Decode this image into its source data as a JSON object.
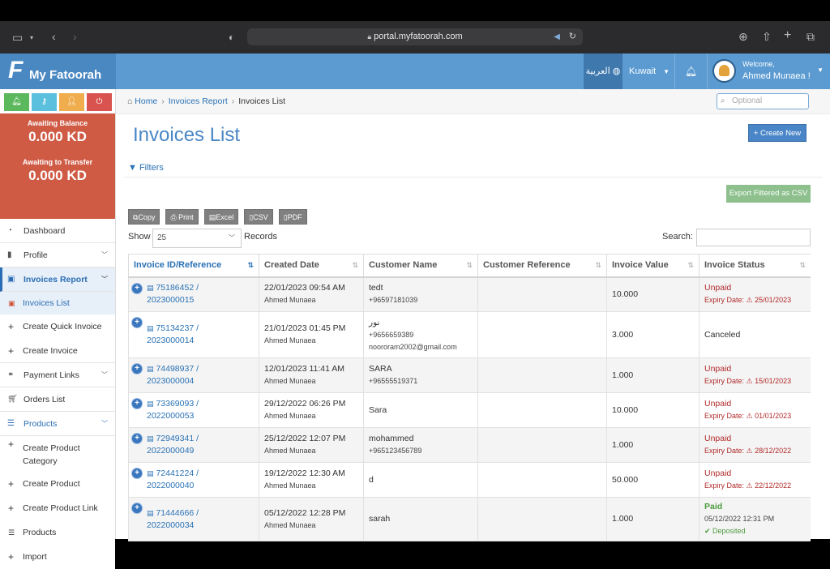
{
  "browser": {
    "url": "portal.myfatoorah.com"
  },
  "header": {
    "logo_letter": "F",
    "logo_text": "My Fatoorah",
    "language": "العربية",
    "country": "Kuwait",
    "welcome": "Welcome,",
    "user_name": "Ahmed Munaea !"
  },
  "sidebar": {
    "awaiting_balance_label": "Awaiting Balance",
    "awaiting_balance": "0.000 KD",
    "awaiting_transfer_label": "Awaiting to Transfer",
    "awaiting_transfer": "0.000 KD",
    "items": [
      {
        "label": "Dashboard"
      },
      {
        "label": "Profile"
      },
      {
        "label": "Invoices Report"
      },
      {
        "label": "Invoices List"
      },
      {
        "label": "Create Quick Invoice"
      },
      {
        "label": "Create Invoice"
      },
      {
        "label": "Payment Links"
      },
      {
        "label": "Orders List"
      },
      {
        "label": "Products"
      },
      {
        "label": "Create Product Category"
      },
      {
        "label": "Create Product"
      },
      {
        "label": "Create Product Link"
      },
      {
        "label": "Products"
      },
      {
        "label": "Import"
      }
    ]
  },
  "breadcrumb": {
    "home": "Home",
    "section": "Invoices Report",
    "current": "Invoices List"
  },
  "search_top": {
    "placeholder": "Optional"
  },
  "page": {
    "title": "Invoices List",
    "create_new": "+ Create New",
    "filters": "Filters",
    "export_csv": "Export Filtered as CSV",
    "tools": [
      "Copy",
      "Print",
      "Excel",
      "CSV",
      "PDF"
    ],
    "show_label": "Show",
    "show_value": "25",
    "records_label": "Records",
    "search_label": "Search:"
  },
  "table": {
    "columns": [
      "Invoice ID/Reference",
      "Created Date",
      "Customer Name",
      "Customer Reference",
      "Invoice Value",
      "Invoice Status"
    ],
    "rows": [
      {
        "id": "75186452 /",
        "ref": "2023000015",
        "date": "22/01/2023 09:54 AM",
        "by": "Ahmed Munaea",
        "name": "tedt",
        "phone": "+96597181039",
        "email": "",
        "value": "10.000",
        "status": "Unpaid",
        "status_detail": "Expiry Date: ⚠ 25/01/2023",
        "kind": "unpaid"
      },
      {
        "id": "75134237 /",
        "ref": "2023000014",
        "date": "21/01/2023 01:45 PM",
        "by": "Ahmed Munaea",
        "name": "نور",
        "phone": "+9656659389",
        "email": "noororam2002@gmail.com",
        "value": "3.000",
        "status": "Canceled",
        "status_detail": "",
        "kind": "canceled"
      },
      {
        "id": "74498937 /",
        "ref": "2023000004",
        "date": "12/01/2023 11:41 AM",
        "by": "Ahmed Munaea",
        "name": "SARA",
        "phone": "+96555519371",
        "email": "",
        "value": "1.000",
        "status": "Unpaid",
        "status_detail": "Expiry Date: ⚠ 15/01/2023",
        "kind": "unpaid"
      },
      {
        "id": "73369093 /",
        "ref": "2022000053",
        "date": "29/12/2022 06:26 PM",
        "by": "Ahmed Munaea",
        "name": "Sara",
        "phone": "",
        "email": "",
        "value": "10.000",
        "status": "Unpaid",
        "status_detail": "Expiry Date: ⚠ 01/01/2023",
        "kind": "unpaid"
      },
      {
        "id": "72949341 /",
        "ref": "2022000049",
        "date": "25/12/2022 12:07 PM",
        "by": "Ahmed Munaea",
        "name": "mohammed",
        "phone": "+965123456789",
        "email": "",
        "value": "1.000",
        "status": "Unpaid",
        "status_detail": "Expiry Date: ⚠ 28/12/2022",
        "kind": "unpaid"
      },
      {
        "id": "72441224 /",
        "ref": "2022000040",
        "date": "19/12/2022 12:30 AM",
        "by": "Ahmed Munaea",
        "name": "d",
        "phone": "",
        "email": "",
        "value": "50.000",
        "status": "Unpaid",
        "status_detail": "Expiry Date: ⚠ 22/12/2022",
        "kind": "unpaid"
      },
      {
        "id": "71444666 /",
        "ref": "2022000034",
        "date": "05/12/2022 12:28 PM",
        "by": "Ahmed Munaea",
        "name": "sarah",
        "phone": "",
        "email": "",
        "value": "1.000",
        "status": "Paid",
        "status_detail": "05/12/2022 12:31 PM",
        "status_extra": "✔ Deposited",
        "kind": "paid"
      }
    ]
  }
}
